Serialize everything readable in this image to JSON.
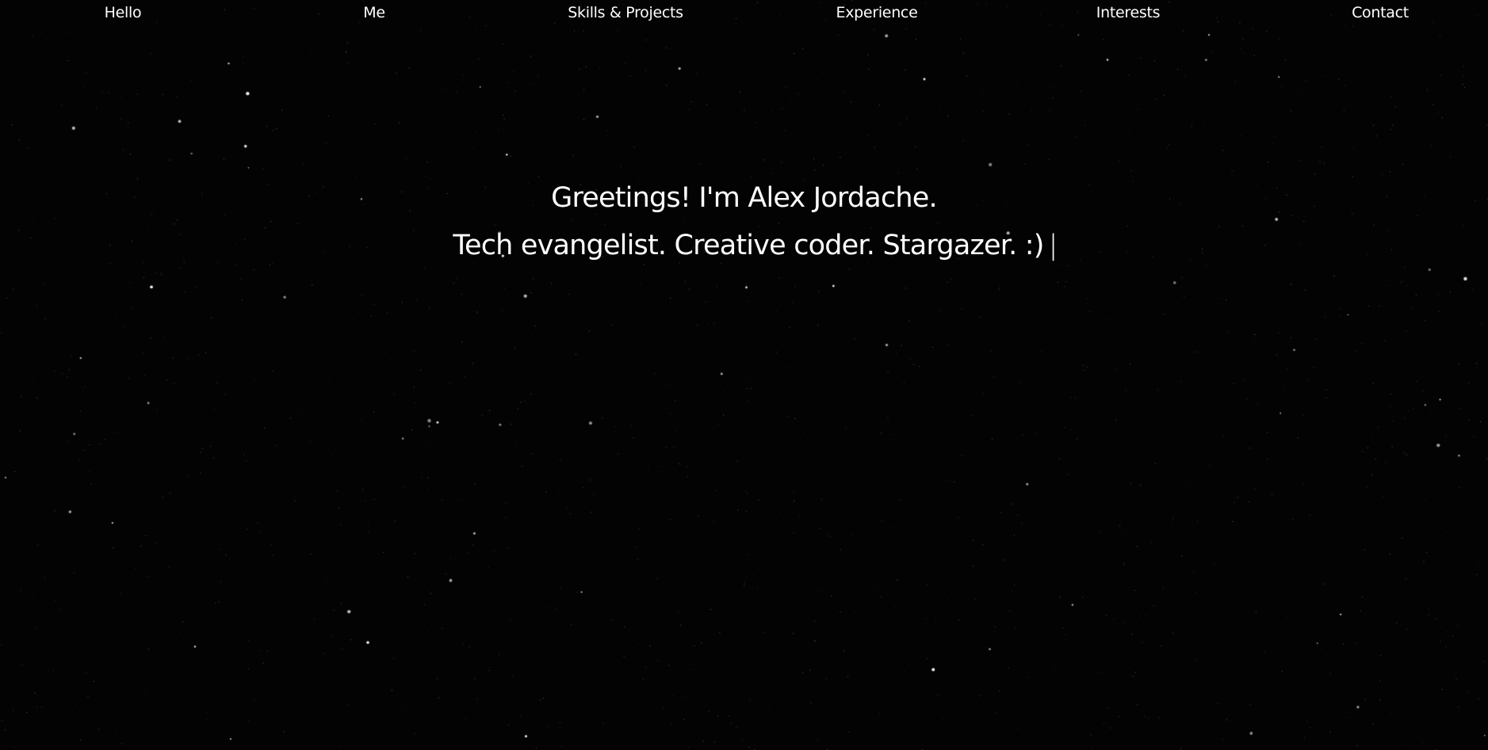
{
  "nav": {
    "items": [
      {
        "label": "Hello"
      },
      {
        "label": "Me"
      },
      {
        "label": "Skills & Projects"
      },
      {
        "label": "Experience"
      },
      {
        "label": "Interests"
      },
      {
        "label": "Contact"
      }
    ]
  },
  "hero": {
    "greeting": "Greetings! I'm Alex Jordache.",
    "tagline": "Tech evangelist. Creative coder. Stargazer. :)",
    "cursor": "|"
  },
  "colors": {
    "background": "#030303",
    "text": "#ffffff",
    "star": "#ffffff"
  }
}
